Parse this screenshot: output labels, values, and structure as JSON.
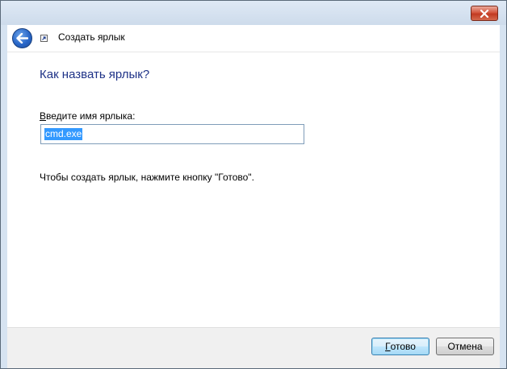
{
  "window": {
    "close_icon": "close-x-icon"
  },
  "header": {
    "back_icon": "back-arrow-icon",
    "shortcut_icon": "shortcut-arrow-icon",
    "title": "Создать ярлык"
  },
  "content": {
    "heading": "Как назвать ярлык?",
    "field_label_accel": "В",
    "field_label_rest": "ведите имя ярлыка:",
    "name_value": "cmd.exe",
    "hint": "Чтобы создать ярлык, нажмите кнопку \"Готово\"."
  },
  "footer": {
    "finish_accel": "Г",
    "finish_rest": "отово",
    "cancel_label": "Отмена"
  },
  "colors": {
    "heading": "#1e3287",
    "selection": "#3399ff",
    "default_button_border": "#3c7fb1"
  }
}
